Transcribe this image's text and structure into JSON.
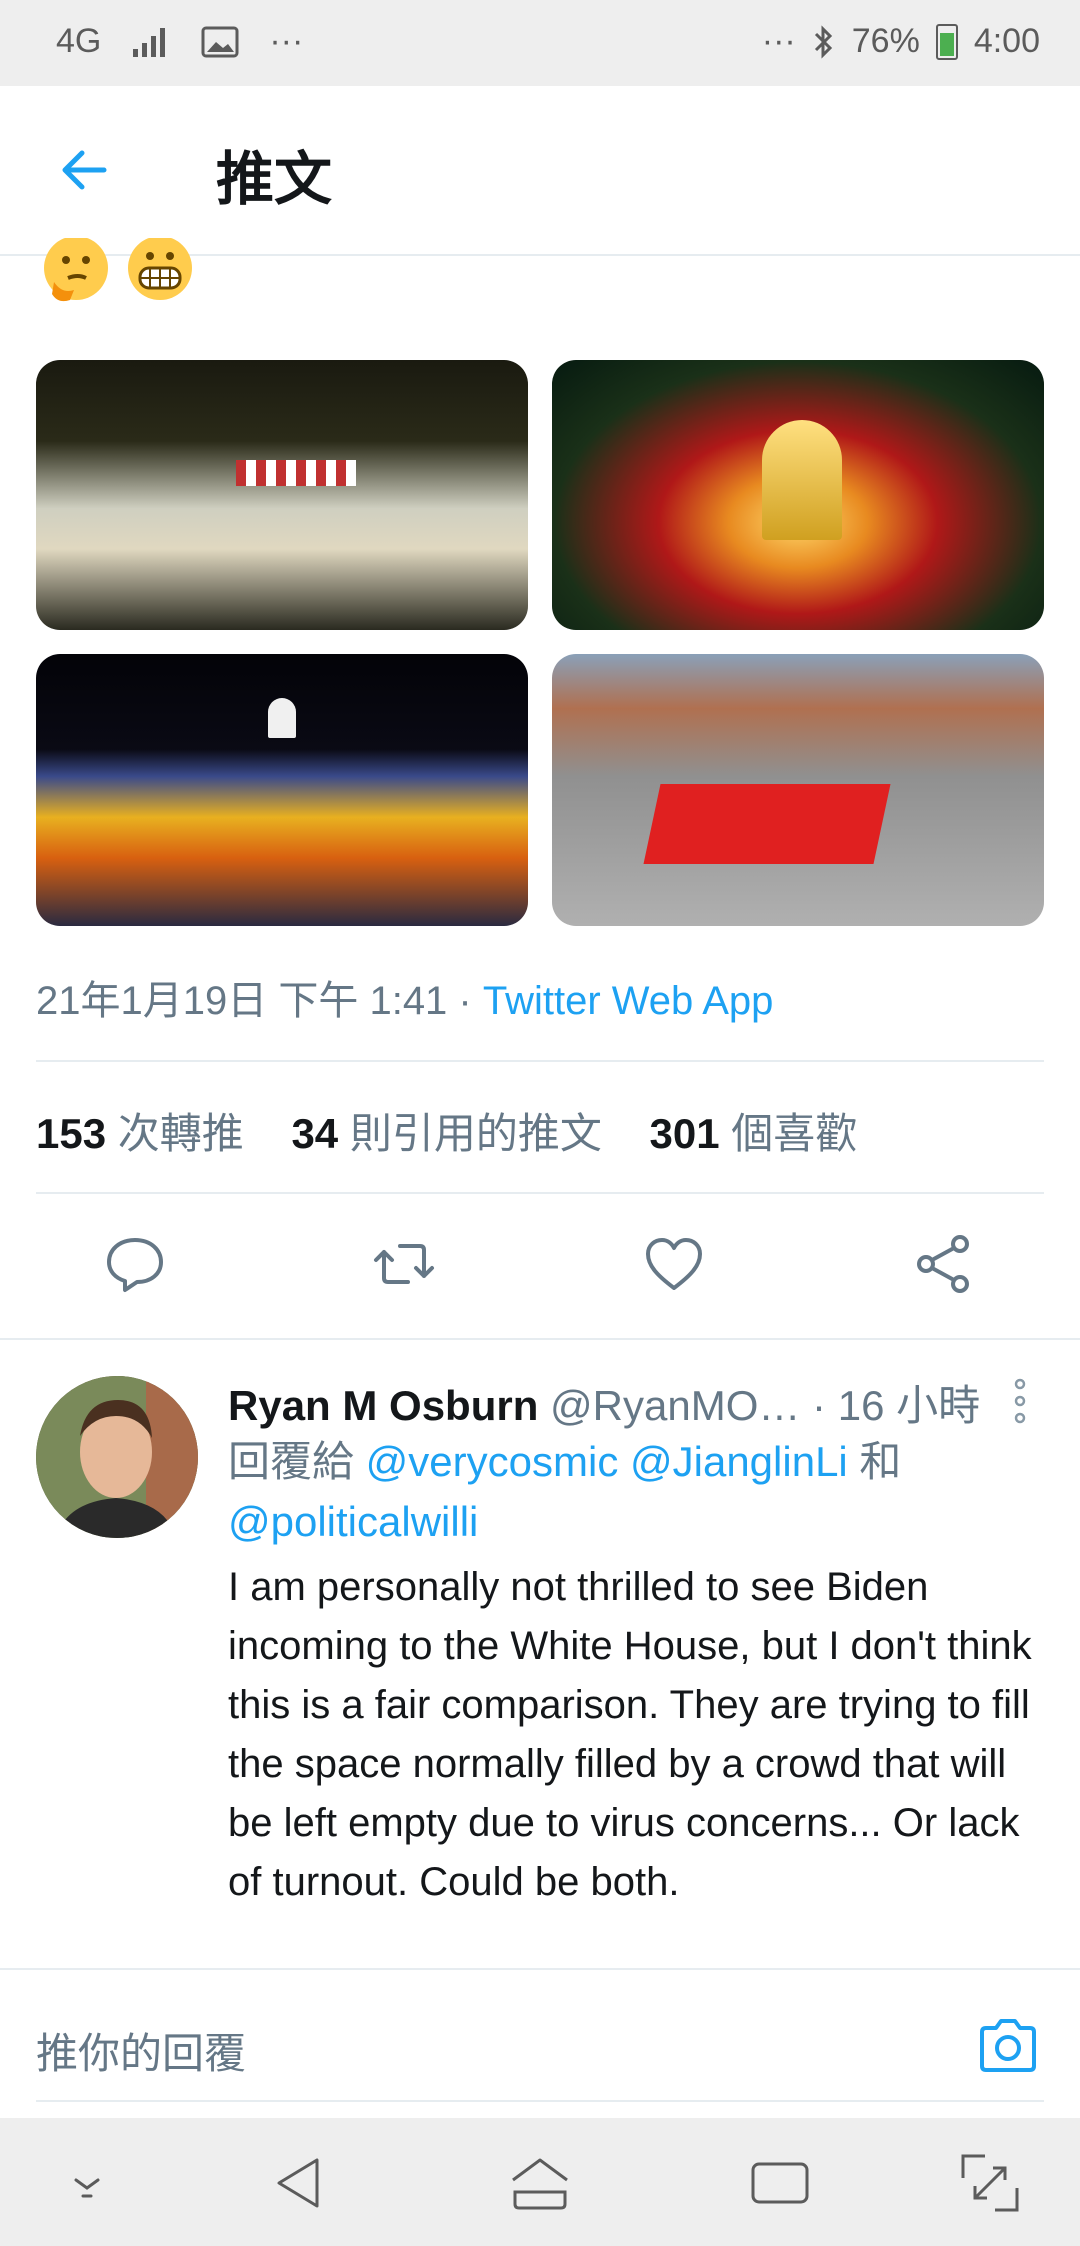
{
  "status_bar": {
    "network": "4G",
    "icons_left": [
      "signal-icon",
      "image-icon",
      "more-dots-icon"
    ],
    "battery": "76%",
    "time": "4:00"
  },
  "header": {
    "title": "推文"
  },
  "tweet": {
    "emojis": [
      "thinking-face-emoji",
      "grimacing-face-emoji"
    ],
    "date_prefix": "21年1月19日 下午 1:41 · ",
    "app": "Twitter Web App",
    "stats": {
      "retweets_count": "153",
      "retweets_label": "次轉推",
      "quotes_count": "34",
      "quotes_label": "則引用的推文",
      "likes_count": "301",
      "likes_label": "個喜歡"
    }
  },
  "reply": {
    "name": "Ryan M Osburn",
    "handle": "@RyanMO…",
    "time": " · 16 小時",
    "replying_prefix": "回覆給 ",
    "mention1": "@verycosmic",
    "mention2": "@JianglinLi",
    "conjunction": " 和",
    "mention3": "@politicalwilli",
    "text": "I am personally not thrilled to see Biden incoming to the White House, but I don't think this is a fair comparison. They are trying to fill the space normally filled by a crowd that will be left empty due to virus concerns... Or lack of turnout. Could be both."
  },
  "compose": {
    "placeholder": "推你的回覆"
  },
  "colors": {
    "accent": "#1da1f2",
    "secondary_text": "#657786",
    "primary_text": "#14171a"
  }
}
